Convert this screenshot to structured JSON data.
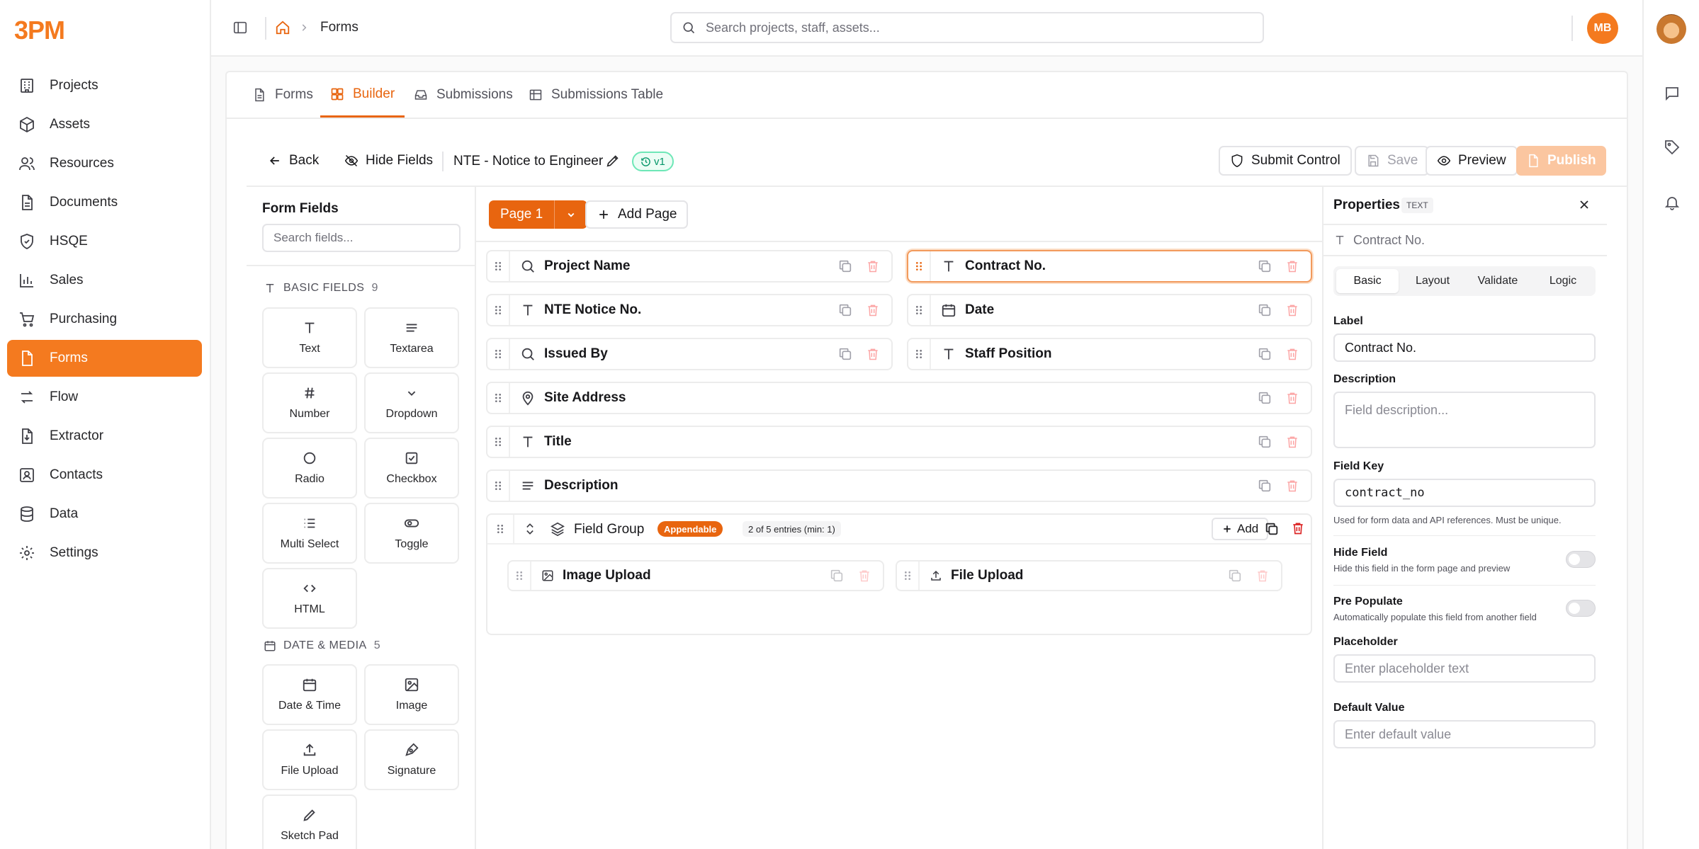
{
  "app": {
    "logo": "3PM",
    "accent": "#f47a1f"
  },
  "nav": {
    "items": [
      {
        "label": "Projects",
        "icon": "building-icon"
      },
      {
        "label": "Assets",
        "icon": "box-icon"
      },
      {
        "label": "Resources",
        "icon": "users-icon"
      },
      {
        "label": "Documents",
        "icon": "document-icon"
      },
      {
        "label": "HSQE",
        "icon": "shield-icon"
      },
      {
        "label": "Sales",
        "icon": "bar-chart-icon"
      },
      {
        "label": "Purchasing",
        "icon": "cart-icon"
      },
      {
        "label": "Forms",
        "icon": "form-icon"
      },
      {
        "label": "Flow",
        "icon": "flow-icon"
      },
      {
        "label": "Extractor",
        "icon": "extractor-icon"
      },
      {
        "label": "Contacts",
        "icon": "contacts-icon"
      },
      {
        "label": "Data",
        "icon": "database-icon"
      },
      {
        "label": "Settings",
        "icon": "gear-icon"
      }
    ],
    "active": "Forms"
  },
  "topbar": {
    "breadcrumb": "Forms",
    "search_placeholder": "Search projects, staff, assets...",
    "user_initials": "MB"
  },
  "tabs": [
    {
      "label": "Forms",
      "icon": "document-icon"
    },
    {
      "label": "Builder",
      "icon": "builder-icon"
    },
    {
      "label": "Submissions",
      "icon": "inbox-icon"
    },
    {
      "label": "Submissions Table",
      "icon": "table-icon"
    }
  ],
  "active_tab": "Builder",
  "toolbar": {
    "back": "Back",
    "hide_fields": "Hide Fields",
    "form_name": "NTE - Notice to Engineer",
    "version": "v1",
    "submit_control": "Submit Control",
    "save": "Save",
    "preview": "Preview",
    "publish": "Publish"
  },
  "palette": {
    "title": "Form Fields",
    "search_placeholder": "Search fields...",
    "sections": [
      {
        "name": "BASIC FIELDS",
        "count": "9",
        "items": [
          "Text",
          "Textarea",
          "Number",
          "Dropdown",
          "Radio",
          "Checkbox",
          "Multi Select",
          "Toggle",
          "HTML"
        ]
      },
      {
        "name": "DATE & MEDIA",
        "count": "5",
        "items": [
          "Date & Time",
          "Image",
          "File Upload",
          "Signature",
          "Sketch Pad"
        ]
      }
    ]
  },
  "canvas": {
    "page_label": "Page 1",
    "add_page": "Add Page",
    "fields": [
      {
        "label": "Project Name",
        "icon": "search-icon"
      },
      {
        "label": "Contract No.",
        "icon": "text-icon"
      },
      {
        "label": "NTE Notice No.",
        "icon": "text-icon"
      },
      {
        "label": "Date",
        "icon": "calendar-icon"
      },
      {
        "label": "Issued By",
        "icon": "search-icon"
      },
      {
        "label": "Staff Position",
        "icon": "text-icon"
      },
      {
        "label": "Site Address",
        "icon": "map-pin-icon"
      },
      {
        "label": "Title",
        "icon": "text-icon"
      },
      {
        "label": "Description",
        "icon": "textarea-icon"
      }
    ],
    "group": {
      "label": "Field Group",
      "badge": "Appendable",
      "entries": "2 of 5 entries (min: 1)",
      "add": "Add",
      "children": [
        {
          "label": "Image Upload",
          "icon": "image-icon"
        },
        {
          "label": "File Upload",
          "icon": "upload-icon"
        }
      ]
    }
  },
  "properties": {
    "title": "Properties",
    "type_badge": "TEXT",
    "field_name": "Contract No.",
    "tabs": [
      "Basic",
      "Layout",
      "Validate",
      "Logic"
    ],
    "active_tab": "Basic",
    "label_label": "Label",
    "label_value": "Contract No.",
    "description_label": "Description",
    "description_placeholder": "Field description...",
    "field_key_label": "Field Key",
    "field_key_value": "contract_no",
    "field_key_help": "Used for form data and API references. Must be unique.",
    "hide_field_label": "Hide Field",
    "hide_field_help": "Hide this field in the form page and preview",
    "pre_populate_label": "Pre Populate",
    "pre_populate_help": "Automatically populate this field from another field",
    "placeholder_label": "Placeholder",
    "placeholder_placeholder": "Enter placeholder text",
    "default_label": "Default Value",
    "default_placeholder": "Enter default value"
  }
}
